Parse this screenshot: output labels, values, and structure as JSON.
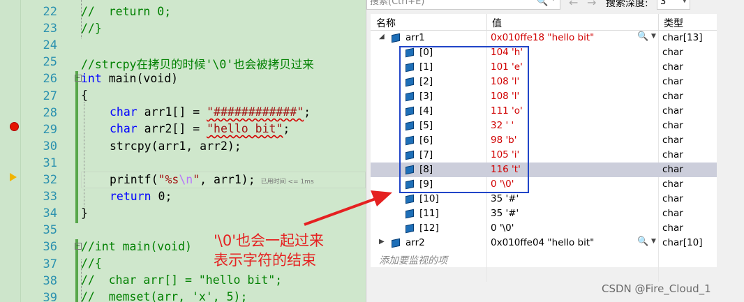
{
  "editor": {
    "lines": [
      {
        "num": "22",
        "text": "//  return 0;"
      },
      {
        "num": "23",
        "text": "//}"
      },
      {
        "num": "24",
        "text": ""
      },
      {
        "num": "25",
        "text": "//strcpy在拷贝的时候'\\0'也会被拷贝过来"
      },
      {
        "num": "26",
        "text": "int main(void)"
      },
      {
        "num": "27",
        "text": "{"
      },
      {
        "num": "28",
        "text": "char arr1[] = \"############\";"
      },
      {
        "num": "29",
        "text": "char arr2[] = \"hello bit\";"
      },
      {
        "num": "30",
        "text": "strcpy(arr1, arr2);"
      },
      {
        "num": "31",
        "text": ""
      },
      {
        "num": "32",
        "text": "printf(\"%s\\n\", arr1);"
      },
      {
        "num": "33",
        "text": "return 0;"
      },
      {
        "num": "34",
        "text": "}"
      },
      {
        "num": "35",
        "text": ""
      },
      {
        "num": "36",
        "text": "//int main(void)"
      },
      {
        "num": "37",
        "text": "//{"
      },
      {
        "num": "38",
        "text": "//  char arr[] = \"hello bit\";"
      },
      {
        "num": "39",
        "text": "//  memset(arr, 'x', 5);"
      }
    ],
    "tokens": {
      "kw_int": "int",
      "kw_char": "char",
      "kw_return": "return",
      "main_void": " main(void)",
      "arr1_decl": " arr1[] = ",
      "arr1_str": "\"############\"",
      "arr2_decl": " arr2[] = ",
      "arr2_str": "\"hello bit\"",
      "semi": ";",
      "strcpy_call": "strcpy(arr1, arr2);",
      "printf_open": "printf(",
      "printf_str_a": "\"%s",
      "printf_esc": "\\n",
      "printf_str_b": "\"",
      "printf_close": ", arr1);",
      "ret_val": " 0;",
      "open_brace": "{",
      "close_brace": "}",
      "comment_22": "//  return 0;",
      "comment_23": "//}",
      "comment_25": "//strcpy在拷贝的时候'\\0'也会被拷贝过来",
      "comment_36": "//int main(void)",
      "comment_37": "//{",
      "comment_38": "//  char arr[] = \"hello bit\";",
      "comment_39": "//  memset(arr, 'x', 5);"
    },
    "elapsed_hint": "已用时间 <= 1ms",
    "annotation_line1": "'\\0'也会一起过来",
    "annotation_line2": "表示字符的结束"
  },
  "watch": {
    "search_placeholder": "搜索(Ctrl+E)",
    "search_depth_label": "搜索深度:",
    "search_depth_value": "3",
    "columns": {
      "name": "名称",
      "value": "值",
      "type": "类型"
    },
    "rows": [
      {
        "name": "arr1",
        "value": "0x010ffe18 \"hello bit\"",
        "type": "char[13]",
        "level": 0,
        "expanded": true,
        "red": true
      },
      {
        "name": "[0]",
        "value": "104 'h'",
        "type": "char",
        "level": 1,
        "red": true
      },
      {
        "name": "[1]",
        "value": "101 'e'",
        "type": "char",
        "level": 1,
        "red": true
      },
      {
        "name": "[2]",
        "value": "108 'l'",
        "type": "char",
        "level": 1,
        "red": true
      },
      {
        "name": "[3]",
        "value": "108 'l'",
        "type": "char",
        "level": 1,
        "red": true
      },
      {
        "name": "[4]",
        "value": "111 'o'",
        "type": "char",
        "level": 1,
        "red": true
      },
      {
        "name": "[5]",
        "value": "32 ' '",
        "type": "char",
        "level": 1,
        "red": true
      },
      {
        "name": "[6]",
        "value": "98 'b'",
        "type": "char",
        "level": 1,
        "red": true
      },
      {
        "name": "[7]",
        "value": "105 'i'",
        "type": "char",
        "level": 1,
        "red": true
      },
      {
        "name": "[8]",
        "value": "116 't'",
        "type": "char",
        "level": 1,
        "red": true,
        "selected": true
      },
      {
        "name": "[9]",
        "value": "0 '\\0'",
        "type": "char",
        "level": 1,
        "red": true
      },
      {
        "name": "[10]",
        "value": "35 '#'",
        "type": "char",
        "level": 1,
        "red": false
      },
      {
        "name": "[11]",
        "value": "35 '#'",
        "type": "char",
        "level": 1,
        "red": false
      },
      {
        "name": "[12]",
        "value": "0 '\\0'",
        "type": "char",
        "level": 1,
        "red": false
      },
      {
        "name": "arr2",
        "value": "0x010ffe04 \"hello bit\"",
        "type": "char[10]",
        "level": 0,
        "expanded": false,
        "red": false
      }
    ],
    "add_watch_placeholder": "添加要监视的项"
  },
  "watermark": "CSDN @Fire_Cloud_1",
  "colors": {
    "editor_bg": "#cfe7cc",
    "keyword": "#0000ff",
    "comment": "#008000",
    "string": "#a31515",
    "changed_value": "#d00000",
    "annotation": "#e52121",
    "highlight_box": "#2145c8",
    "breakpoint": "#e51400"
  }
}
